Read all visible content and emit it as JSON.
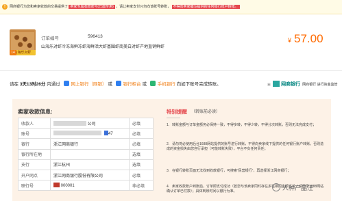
{
  "notice": {
    "icon": "warning-icon",
    "part1": "网商银行为您和卖家收款的交易提供了",
    "highlight1": "卖家专属收款账号(已面专用)",
    "part2": "，请让卖家支付只勿向该账号转账，",
    "highlight2": "不得向卖家编写提供的任何银行账户转账。"
  },
  "order": {
    "thumb_badge_num": "14",
    "thumb_badge_text": "山海乐对虾",
    "order_no_label": "订单编号",
    "order_no": "596413",
    "product_title": "山海乐对虾冷冻海鲜冻虾海鲜活大虾基围虾南美白对虾产地直销鲜虾",
    "currency": "¥",
    "amount": "57.00"
  },
  "deadline": {
    "prefix": "请在",
    "time": "3天13时26分",
    "mid": "内通过",
    "bank1": "网上银行（网银）",
    "or1": "或",
    "bank2": "银行柜台",
    "or2": "或",
    "bank3": "手机银行",
    "suffix": "向如下账号完成转账。"
  },
  "brand": {
    "name": "网商银行",
    "service": "网商银行 进行资金监管"
  },
  "account": {
    "title": "卖家收款信息:",
    "rows": [
      {
        "key": "收款人",
        "value": "公司",
        "req": "必填",
        "mask": "name"
      },
      {
        "key": "账号",
        "value": "47",
        "req": "必填",
        "mask": "acct"
      },
      {
        "key": "银行",
        "value": "浙江网商银行",
        "req": "必填",
        "mask": ""
      },
      {
        "key": "银行所在地",
        "value": "",
        "req": "选填",
        "mask": ""
      },
      {
        "key": "支行",
        "value": "浙江杭州",
        "req": "选填",
        "mask": ""
      },
      {
        "key": "开户网点",
        "value": "浙江网商银行股份有限公司",
        "req": "必填",
        "mask": ""
      },
      {
        "key": "联行号",
        "value": "000001",
        "req": "非必填",
        "mask": "code"
      }
    ]
  },
  "notes": {
    "title": "特别提醒",
    "subtitle": "（转账前必读）",
    "sub2": "————",
    "items": [
      {
        "n": "1.",
        "text": "转账金额与订单金额务必保持一致，不得多转，不得少转，不得分次转账，否则无法完成支付；"
      },
      {
        "n": "2.",
        "text": "请勿将必使用后台1688网站提供的账号进行转账，不得向卖家线下提供的任何银行账户转账。否则造成的资金损失由您自行承担（可能转账失败），平台不负任何责任；"
      },
      {
        "n": "3.",
        "text": "在银行转账页面无法找到收款银行，可搜索“民营银行”，再选择浙江网商银行；"
      },
      {
        "n": "4.",
        "text": "卖家收款账户到账后，订单即支付成功（若您与该卖家同时存在多笔相同金额订单，请登录1688网站确认订单已付款）；具体到账时间以银行为准。"
      }
    ]
  },
  "watermark": "人种产品汪"
}
